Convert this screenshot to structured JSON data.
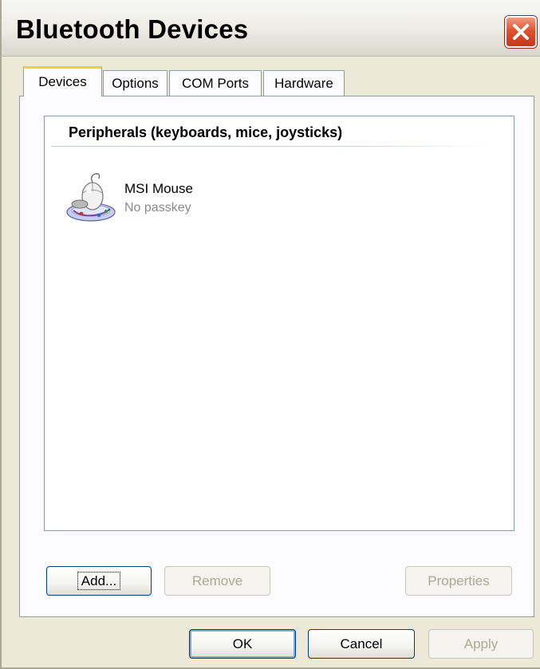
{
  "window": {
    "title": "Bluetooth Devices"
  },
  "tabs": [
    {
      "label": "Devices",
      "active": true
    },
    {
      "label": "Options",
      "active": false
    },
    {
      "label": "COM Ports",
      "active": false
    },
    {
      "label": "Hardware",
      "active": false
    }
  ],
  "devices_panel": {
    "group_header": "Peripherals (keyboards, mice, joysticks)",
    "items": [
      {
        "name": "MSI Mouse",
        "status": "No passkey",
        "icon": "mouse-icon"
      }
    ]
  },
  "panel_buttons": {
    "add": "Add...",
    "remove": "Remove",
    "properties": "Properties"
  },
  "dialog_buttons": {
    "ok": "OK",
    "cancel": "Cancel",
    "apply": "Apply"
  },
  "colors": {
    "dialog_bg": "#ece9d8",
    "active_tab_accent": "#ffc83c",
    "close_button": "#e0522f",
    "button_border": "#003c74"
  }
}
